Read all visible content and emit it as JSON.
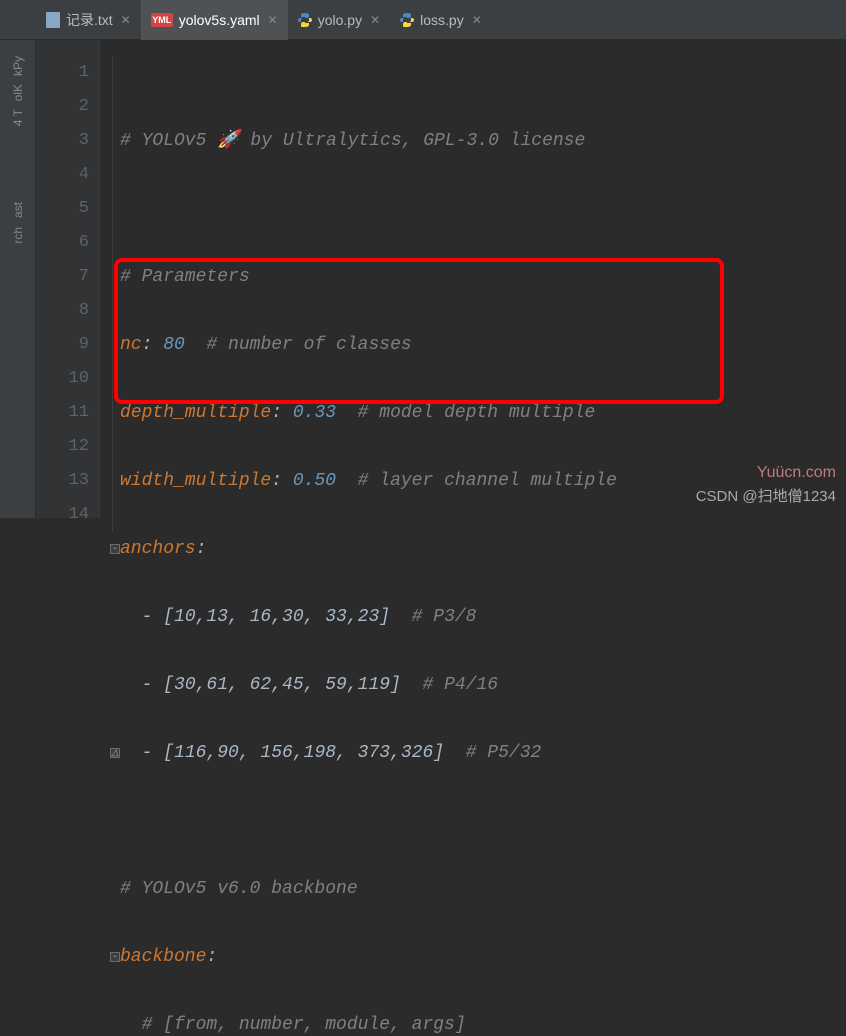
{
  "tabs": [
    {
      "label": "记录.txt",
      "icon": "txt"
    },
    {
      "label": "yolov5s.yaml",
      "icon": "yml",
      "active": true
    },
    {
      "label": "yolo.py",
      "icon": "py"
    },
    {
      "label": "loss.py",
      "icon": "py"
    }
  ],
  "sidebar": {
    "items": [
      "kPy",
      "olK",
      "4 T",
      "ast",
      "rch"
    ]
  },
  "gutter": {
    "lines": [
      "1",
      "2",
      "3",
      "4",
      "5",
      "6",
      "7",
      "8",
      "9",
      "10",
      "11",
      "12",
      "13",
      "14"
    ]
  },
  "code": {
    "l1": {
      "comment": "# YOLOv5 🚀 by Ultralytics, GPL-3.0 license"
    },
    "l3": {
      "comment": "# Parameters"
    },
    "l4": {
      "key": "nc",
      "colon": ": ",
      "val": "80",
      "sp": "  ",
      "comment": "# number of classes"
    },
    "l5": {
      "key": "depth_multiple",
      "colon": ": ",
      "val": "0.33",
      "sp": "  ",
      "comment": "# model depth multiple"
    },
    "l6": {
      "key": "width_multiple",
      "colon": ": ",
      "val": "0.50",
      "sp": "  ",
      "comment": "# layer channel multiple"
    },
    "l7": {
      "key": "anchors",
      "colon": ":"
    },
    "l8": {
      "dash": "  - ",
      "arr": "[10,13, 16,30, 33,23]",
      "sp": "  ",
      "comment": "# P3/8"
    },
    "l9": {
      "dash": "  - ",
      "arr": "[30,61, 62,45, 59,119]",
      "sp": "  ",
      "comment": "# P4/16"
    },
    "l10": {
      "dash": "  - ",
      "arr": "[116,90, 156,198, 373,326]",
      "sp": "  ",
      "comment": "# P5/32"
    },
    "l12": {
      "comment": "# YOLOv5 v6.0 backbone"
    },
    "l13": {
      "key": "backbone",
      "colon": ":"
    },
    "l14": {
      "indent": "  ",
      "comment": "# [from, number, module, args]"
    }
  },
  "watermark": {
    "top": "Yuücn.com",
    "bottom": "CSDN @扫地僧1234"
  }
}
